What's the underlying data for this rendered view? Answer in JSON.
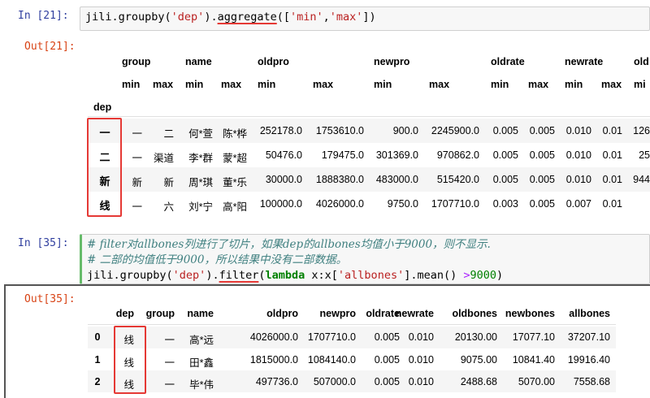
{
  "cell21": {
    "in_prompt": "In  [21]:",
    "out_prompt": "Out[21]:",
    "code": {
      "pre": "jili.groupby(",
      "s1": "'dep'",
      "mid": ").",
      "method": "aggregate",
      "open": "([",
      "s2": "'min'",
      "comma": ",",
      "s3": "'max'",
      "close": "])"
    },
    "table": {
      "top_headers": [
        "group",
        "name",
        "oldpro",
        "newpro",
        "oldrate",
        "newrate",
        "old"
      ],
      "sub_headers": [
        "min",
        "max",
        "min",
        "max",
        "min",
        "max",
        "min",
        "max",
        "min",
        "max",
        "min",
        "max",
        "mi"
      ],
      "index_name": "dep",
      "rows": [
        {
          "idx": "一",
          "cells": [
            "一",
            "二",
            "何*萱",
            "陈*桦",
            "252178.0",
            "1753610.0",
            "900.0",
            "2245900.0",
            "0.005",
            "0.005",
            "0.010",
            "0.01",
            "126"
          ]
        },
        {
          "idx": "二",
          "cells": [
            "一",
            "渠道",
            "李*群",
            "蒙*超",
            "50476.0",
            "179475.0",
            "301369.0",
            "970862.0",
            "0.005",
            "0.005",
            "0.010",
            "0.01",
            "25"
          ]
        },
        {
          "idx": "新",
          "cells": [
            "新",
            "新",
            "周*琪",
            "董*乐",
            "30000.0",
            "1888380.0",
            "483000.0",
            "515420.0",
            "0.005",
            "0.005",
            "0.010",
            "0.01",
            "944"
          ]
        },
        {
          "idx": "线",
          "cells": [
            "一",
            "六",
            "刘*宁",
            "高*阳",
            "100000.0",
            "4026000.0",
            "9750.0",
            "1707710.0",
            "0.003",
            "0.005",
            "0.007",
            "0.01",
            ""
          ]
        }
      ]
    }
  },
  "cell35": {
    "in_prompt": "In  [35]:",
    "out_prompt": "Out[35]:",
    "comment1": "# filter对allbones列进行了切片，如果dep的allbones均值小于9000，则不显示.",
    "comment2": "# 二部的均值低于9000，所以结果中没有二部数据。",
    "code": {
      "pre": "jili.groupby(",
      "s1": "'dep'",
      "mid": ").",
      "method": "filter",
      "open": "(",
      "kw": "lambda",
      "x": " x:x[",
      "s2": "'allbones'",
      "rest": "].mean() ",
      "op": ">",
      "num": "9000",
      "close": ")"
    },
    "table": {
      "headers": [
        "dep",
        "group",
        "name",
        "oldpro",
        "newpro",
        "oldrate",
        "newrate",
        "oldbones",
        "newbones",
        "allbones"
      ],
      "rows": [
        {
          "idx": "0",
          "cells": [
            "线",
            "一",
            "高*远",
            "4026000.0",
            "1707710.0",
            "0.005",
            "0.010",
            "20130.00",
            "17077.10",
            "37207.10"
          ]
        },
        {
          "idx": "1",
          "cells": [
            "线",
            "一",
            "田*鑫",
            "1815000.0",
            "1084140.0",
            "0.005",
            "0.010",
            "9075.00",
            "10841.40",
            "19916.40"
          ]
        },
        {
          "idx": "2",
          "cells": [
            "线",
            "一",
            "毕*伟",
            "497736.0",
            "507000.0",
            "0.005",
            "0.010",
            "2488.68",
            "5070.00",
            "7558.68"
          ]
        }
      ]
    }
  },
  "colors": {
    "highlight": "#e53935",
    "prompt_in": "#303f9f",
    "prompt_out": "#d84315"
  }
}
